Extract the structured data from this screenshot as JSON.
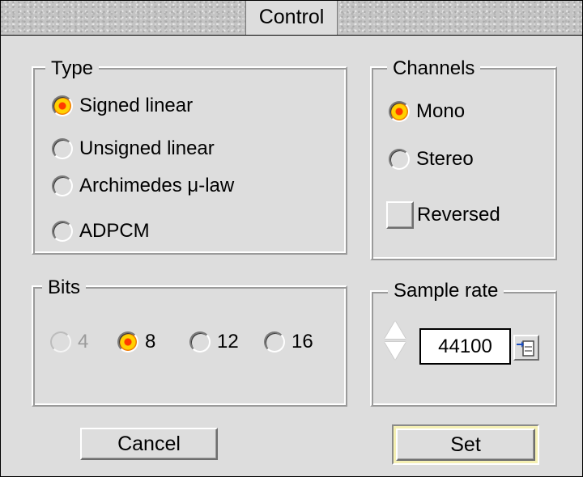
{
  "window": {
    "title": "Control"
  },
  "type_group": {
    "label": "Type",
    "options": [
      {
        "label": "Signed linear",
        "selected": true
      },
      {
        "label": "Unsigned linear",
        "selected": false
      },
      {
        "label": "Archimedes μ-law",
        "selected": false
      },
      {
        "label": "ADPCM",
        "selected": false
      }
    ]
  },
  "channels_group": {
    "label": "Channels",
    "options": [
      {
        "label": "Mono",
        "selected": true
      },
      {
        "label": "Stereo",
        "selected": false
      }
    ],
    "reversed": {
      "label": "Reversed",
      "checked": false
    }
  },
  "bits_group": {
    "label": "Bits",
    "options": [
      {
        "label": "4",
        "selected": false,
        "enabled": false
      },
      {
        "label": "8",
        "selected": true,
        "enabled": true
      },
      {
        "label": "12",
        "selected": false,
        "enabled": true
      },
      {
        "label": "16",
        "selected": false,
        "enabled": true
      }
    ]
  },
  "sample_rate_group": {
    "label": "Sample rate",
    "value": "44100",
    "icons": [
      "up-arrow-icon",
      "down-arrow-icon",
      "popup-menu-icon"
    ]
  },
  "buttons": {
    "cancel": "Cancel",
    "set": "Set"
  },
  "colors": {
    "window_bg": "#dddddd",
    "radio_selected": "#ffd100",
    "default_button_highlight": "#f5f0b4"
  }
}
